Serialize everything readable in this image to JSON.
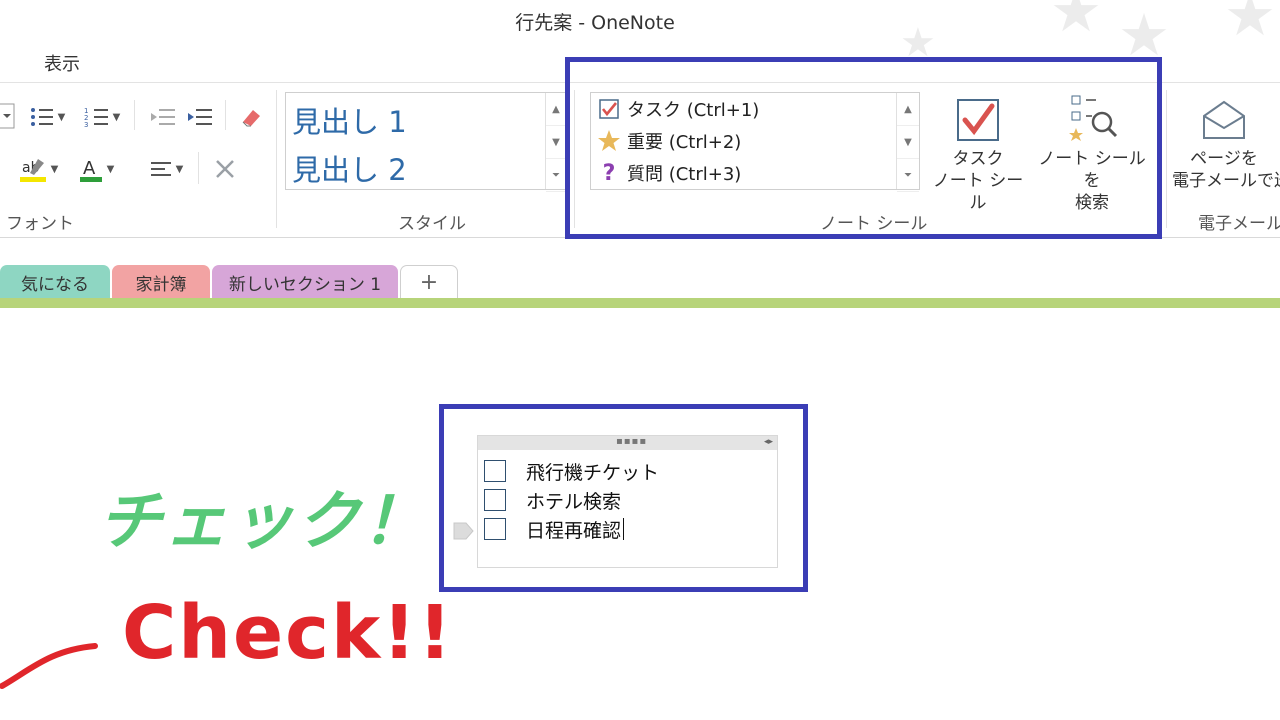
{
  "window": {
    "title": "行先案 - OneNote"
  },
  "menu": {
    "view": "表示"
  },
  "ribbon": {
    "groups": {
      "font": "フォント",
      "styles": "スタイル",
      "tags": "ノート シール",
      "email": "電子メール"
    },
    "styles": {
      "heading1": "見出し 1",
      "heading2": "見出し 2"
    },
    "tags": [
      {
        "label": "タスク (Ctrl+1)",
        "icon": "checkbox-check-icon"
      },
      {
        "label": "重要 (Ctrl+2)",
        "icon": "star-icon"
      },
      {
        "label": "質問 (Ctrl+3)",
        "icon": "question-icon"
      }
    ],
    "todo_button": {
      "line1": "タスク",
      "line2": "ノート シール"
    },
    "find_tags_button": {
      "line1": "ノート シールを",
      "line2": "検索"
    },
    "email_button": {
      "line1": "ページを",
      "line2": "電子メールで送"
    }
  },
  "sections": [
    {
      "label": "気になる",
      "color": "#8ed6c2"
    },
    {
      "label": "家計簿",
      "color": "#f2a3a3"
    },
    {
      "label": "新しいセクション 1",
      "color": "#d7a6d8"
    },
    {
      "label": "+",
      "color": "#ffffff"
    }
  ],
  "note": {
    "items": [
      "飛行機チケット",
      "ホテル検索",
      "日程再確認"
    ]
  },
  "annotations": {
    "japanese": "チェック！",
    "english": "Check!!"
  },
  "colors": {
    "highlight": "#3b3db5",
    "accent_line": "#b7d47a",
    "check_red": "#d9534f"
  }
}
